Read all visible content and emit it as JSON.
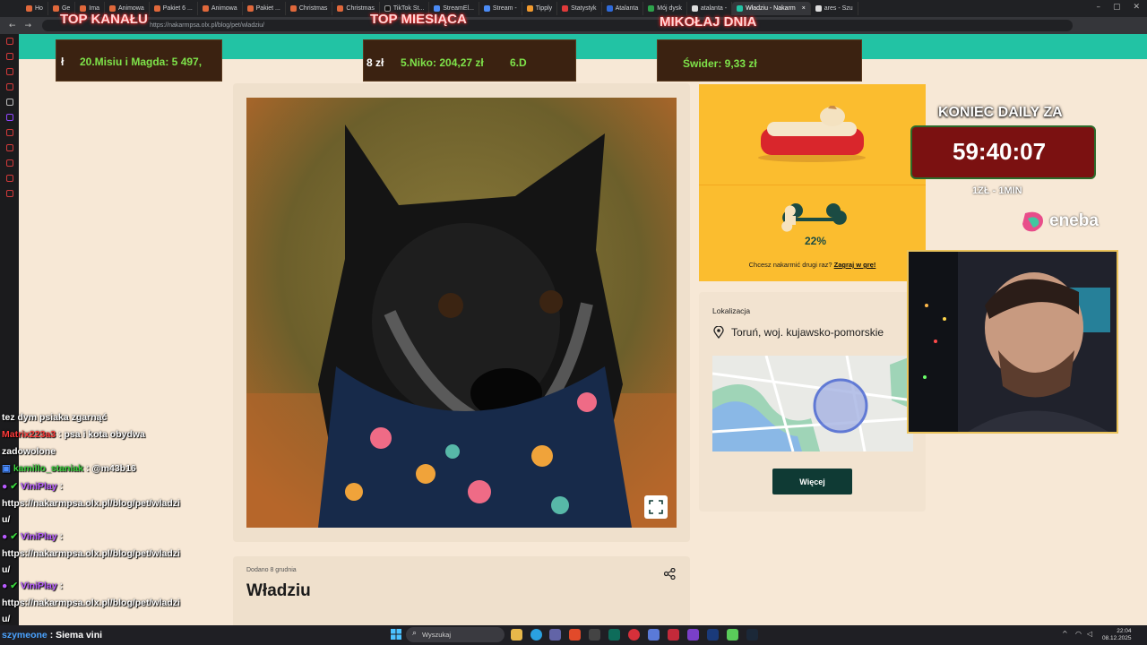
{
  "browser": {
    "tabs": [
      "Ho",
      "Ge",
      "Ima",
      "Animowa",
      "Pakiet 6 ...",
      "Animowa",
      "Pakiet ...",
      "Christmas",
      "Christmas",
      "TikTok St...",
      "StreamEl...",
      "Stream -",
      "Tipply",
      "Statystyk",
      "Atalanta",
      "Mój dysk",
      "atalanta -",
      "Władziu - Nakarm",
      "ares - Szu"
    ],
    "url": "https://nakarmpsa.olx.pl/blog/pet/wladziu/",
    "active_tab_index": 17
  },
  "page": {
    "added_label": "Dodano 8 grudnia",
    "pet_name": "Władziu",
    "feed_percent": "22%",
    "feed_prompt": "Chcesz nakarmić drugi raz?",
    "feed_link": "Zagraj w grę!",
    "location_title": "Lokalizacja",
    "location_value": "Toruń, woj. kujawsko-pomorskie",
    "more_button": "Więcej",
    "accent_color": "#22c3a4",
    "button_color": "#0f3a34",
    "yellow_color": "#fbbd2f"
  },
  "overlay": {
    "panels": [
      {
        "title": "TOP KANAŁU",
        "text_pre": "ł",
        "text": "20.Misiu i Magda: 5 497,"
      },
      {
        "title": "TOP MIESIĄCA",
        "text_pre": "8 zł",
        "text": "5.Niko: 204,27 zł",
        "text_post": "6.D"
      },
      {
        "title": "MIKOŁAJ DNIA",
        "text": "Świder: 9,33 zł"
      }
    ],
    "daily_title": "KONIEC DAILY ZA",
    "timer": "59:40:07",
    "rate": "1ZŁ - 1MIN",
    "sponsor": "eneba"
  },
  "chat": {
    "lines": [
      {
        "user": "",
        "msg": "tez dym psiaka zgarnąć"
      },
      {
        "user": "Matrix223a3",
        "msg": ": psa i kota obydwa"
      },
      {
        "user": "",
        "msg": "zadowolone"
      },
      {
        "user": "kamillo_staniak",
        "msg": ": @m43b16"
      },
      {
        "user": "ViniPlay",
        "msg": ":"
      },
      {
        "user": "",
        "msg": "https://nakarmpsa.olx.pl/blog/pet/wladzi"
      },
      {
        "user": "",
        "msg": "u/"
      },
      {
        "user": "ViniPlay",
        "msg": ":"
      },
      {
        "user": "",
        "msg": "https://nakarmpsa.olx.pl/blog/pet/wladzi"
      },
      {
        "user": "",
        "msg": "u/"
      },
      {
        "user": "ViniPlay",
        "msg": ":"
      },
      {
        "user": "",
        "msg": "https://nakarmpsa.olx.pl/blog/pet/wladzi"
      },
      {
        "user": "",
        "msg": "u/"
      }
    ],
    "input_user": "szymeone",
    "input_msg": ": Siema vini",
    "user_colors": {
      "Matrix223a3": "#ff3b3b",
      "kamillo_staniak": "#39d13c",
      "ViniPlay": "#b85cff"
    }
  },
  "taskbar": {
    "search_placeholder": "Wyszukaj",
    "time": "22:04",
    "date": "08.12.2025"
  }
}
